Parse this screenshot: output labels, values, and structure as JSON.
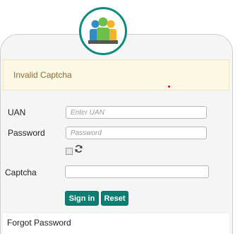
{
  "alert": {
    "message": "Invalid Captcha"
  },
  "form": {
    "uan_label": "UAN",
    "uan_placeholder": "Enter UAN",
    "password_label": "Password",
    "password_placeholder": "Password",
    "captcha_label": "Captcha",
    "captcha_value": ""
  },
  "buttons": {
    "sign_in": "Sign in",
    "reset": "Reset"
  },
  "links": {
    "forgot_password": "Forgot Password"
  },
  "icons": {
    "logo": "group-of-people-icon",
    "refresh": "refresh-icon",
    "captcha_image": "broken-image-icon"
  },
  "colors": {
    "primary": "#0f7d72",
    "alert_bg": "#fcf8e3",
    "alert_text": "#8a6d3b"
  }
}
